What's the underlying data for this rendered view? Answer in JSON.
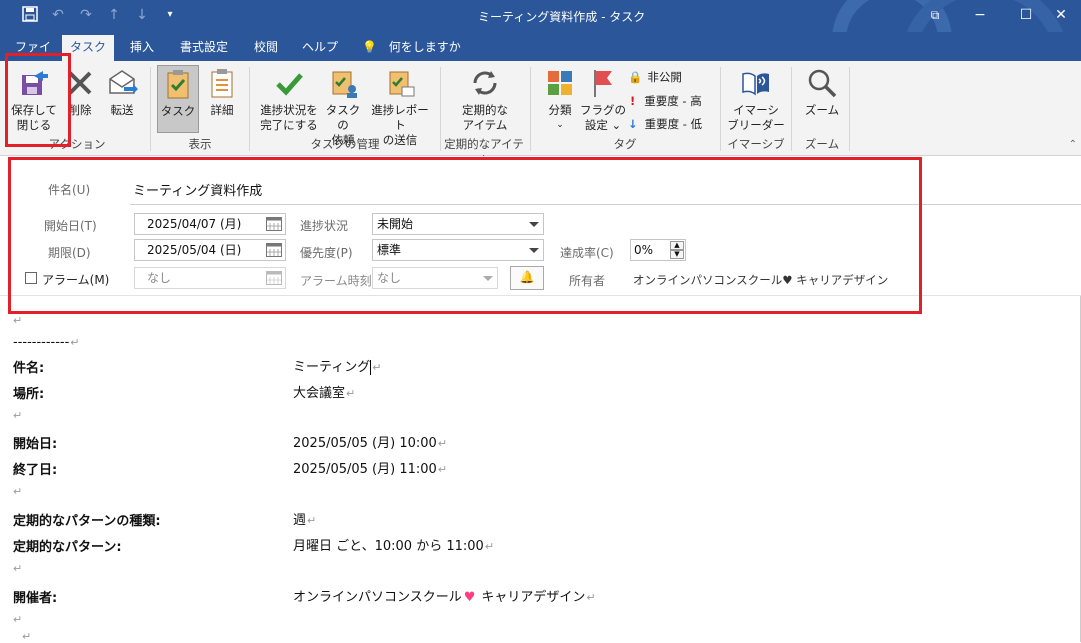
{
  "window": {
    "title": "ミーティング資料作成 - タスク"
  },
  "qat": {
    "save": "save-icon",
    "undo": "undo-icon",
    "redo": "redo-icon",
    "up": "up-arrow-icon",
    "down": "down-arrow-icon",
    "more": "customize-icon"
  },
  "tabs": {
    "file": "ファイル",
    "task": "タスク",
    "insert": "挿入",
    "format": "書式設定",
    "review": "校閲",
    "help": "ヘルプ",
    "tellme": "何をしますか"
  },
  "ribbon": {
    "save_close": "保存して",
    "save_close2": "閉じる",
    "delete": "削除",
    "forward": "転送",
    "group_action": "アクション",
    "task": "タスク",
    "details": "詳細",
    "group_show": "表示",
    "mark_complete": "進捗状況を",
    "mark_complete2": "完了にする",
    "assign": "タスクの",
    "assign2": "依頼",
    "send_report": "進捗レポート",
    "send_report2": "の送信",
    "group_manage": "タスクの管理",
    "recurrence": "定期的な",
    "recurrence2": "アイテム",
    "group_recur": "定期的なアイテム",
    "categorize": "分類",
    "followup": "フラグの",
    "followup2": "設定",
    "private": "非公開",
    "high": "重要度 - 高",
    "low": "重要度 - 低",
    "group_tags": "タグ",
    "immersive": "イマーシ",
    "immersive2": "ブリーダー",
    "group_immersive": "イマーシブ",
    "zoom": "ズーム",
    "group_zoom": "ズーム"
  },
  "form": {
    "subject_label": "件名(U)",
    "subject": "ミーティング資料作成",
    "start_label": "開始日(T)",
    "start": "2025/04/07 (月)",
    "due_label": "期限(D)",
    "due": "2025/05/04 (日)",
    "reminder_label": "アラーム(M)",
    "reminder_date": "なし",
    "status_label": "進捗状況",
    "status": "未開始",
    "priority_label": "優先度(P)",
    "priority": "標準",
    "reminder_time_label": "アラーム時刻",
    "reminder_time": "なし",
    "complete_label": "達成率(C)",
    "complete": "0%",
    "owner_label": "所有者",
    "owner": "オンラインパソコンスクール♥ キャリアデザイン"
  },
  "body": {
    "dashes": "------------",
    "subject_label": "件名:",
    "subject": "ミーティング",
    "location_label": "場所:",
    "location": "大会議室",
    "start_label": "開始日:",
    "start": "2025/05/05 (月) 10:00",
    "end_label": "終了日:",
    "end": "2025/05/05 (月) 11:00",
    "pattern_type_label": "定期的なパターンの種類:",
    "pattern_type": "週",
    "pattern_label": "定期的なパターン:",
    "pattern": "月曜日 ごと、10:00 から 11:00",
    "organizer_label": "開催者:",
    "organizer": "オンラインパソコンスクール",
    "organizer2": "キャリアデザイン",
    "ret": "↵"
  },
  "colors": {
    "accent": "#2b579a",
    "highlight": "#e2202a"
  }
}
